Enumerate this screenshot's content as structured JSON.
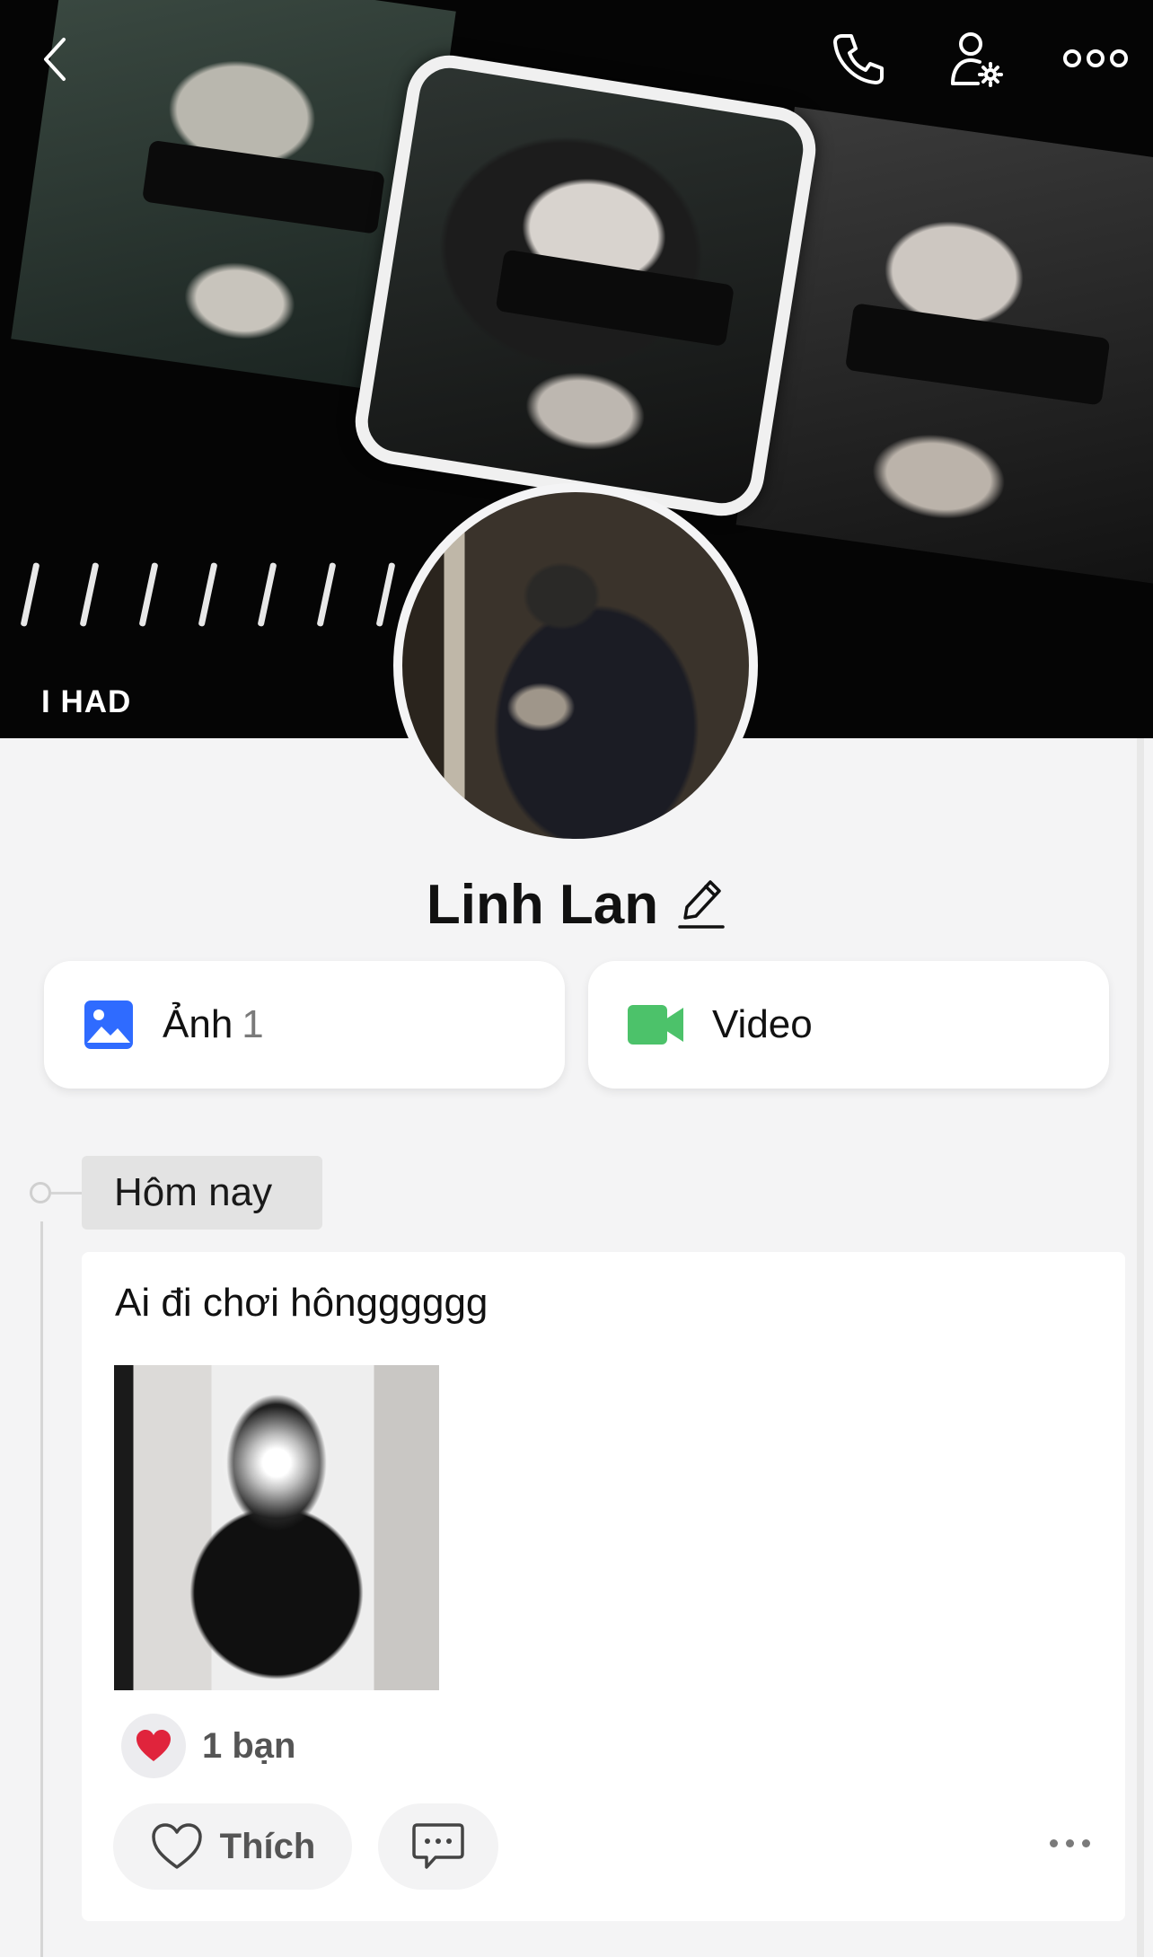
{
  "cover": {
    "caption": "I HAD"
  },
  "header": {
    "back_icon": "chevron-left-icon",
    "call_icon": "phone-icon",
    "profile_settings_icon": "user-gear-icon",
    "more_icon": "more-dots-icon"
  },
  "profile": {
    "name": "Linh Lan",
    "edit_icon": "pencil-icon"
  },
  "media": {
    "photos_label": "Ảnh",
    "photos_count": "1",
    "videos_label": "Video",
    "photos_icon_color": "#2f6bff",
    "videos_icon_color": "#4cc26a"
  },
  "timeline": {
    "date_label": "Hôm nay"
  },
  "post": {
    "text": "Ai đi chơi hôngggggg",
    "reaction_count": "1 bạn",
    "like_label": "Thích",
    "heart_color": "#e0243c"
  }
}
